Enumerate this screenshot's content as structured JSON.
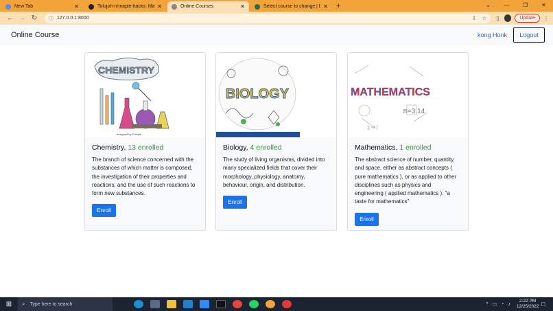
{
  "browser": {
    "tabs": [
      {
        "title": "New Tab",
        "active": false
      },
      {
        "title": "Tolujoh-n/maple-hacks: Maple h",
        "active": false
      },
      {
        "title": "Online Courses",
        "active": true
      },
      {
        "title": "Select course to change | Djang",
        "active": false
      }
    ],
    "url": "127.0.0.1:8000",
    "update_label": "Update"
  },
  "navbar": {
    "brand": "Online Course",
    "user": "kong Honk",
    "logout_label": "Logout"
  },
  "courses": [
    {
      "name": "Chemistry,",
      "enrolled": "13 enrolled",
      "description": "The branch of science concerned with the substances of which matter is composed, the investigation of their properties and reactions, and the use of such reactions to form new substances.",
      "enroll_label": "Enroll",
      "image_text": "CHEMISTRY"
    },
    {
      "name": "Biology,",
      "enrolled": "4 enrolled",
      "description": "The study of living organisms, divided into many specialized fields that cover their morphology, physiology, anatomy, behaviour, origin, and distribution.",
      "enroll_label": "Enroll",
      "image_text": "BIOLOGY"
    },
    {
      "name": "Mathematics,",
      "enrolled": "1 enrolled",
      "description": "The abstract science of number, quantity, and space, either as abstract concepts ( pure mathematics ), or as applied to other disciplines such as physics and engineering ( applied mathematics ). \"a taste for mathematics\"",
      "enroll_label": "Enroll",
      "image_text": "MATHEMATICS"
    }
  ],
  "taskbar": {
    "search_placeholder": "Type here to search",
    "time": "2:22 PM",
    "date": "12/25/2022"
  }
}
